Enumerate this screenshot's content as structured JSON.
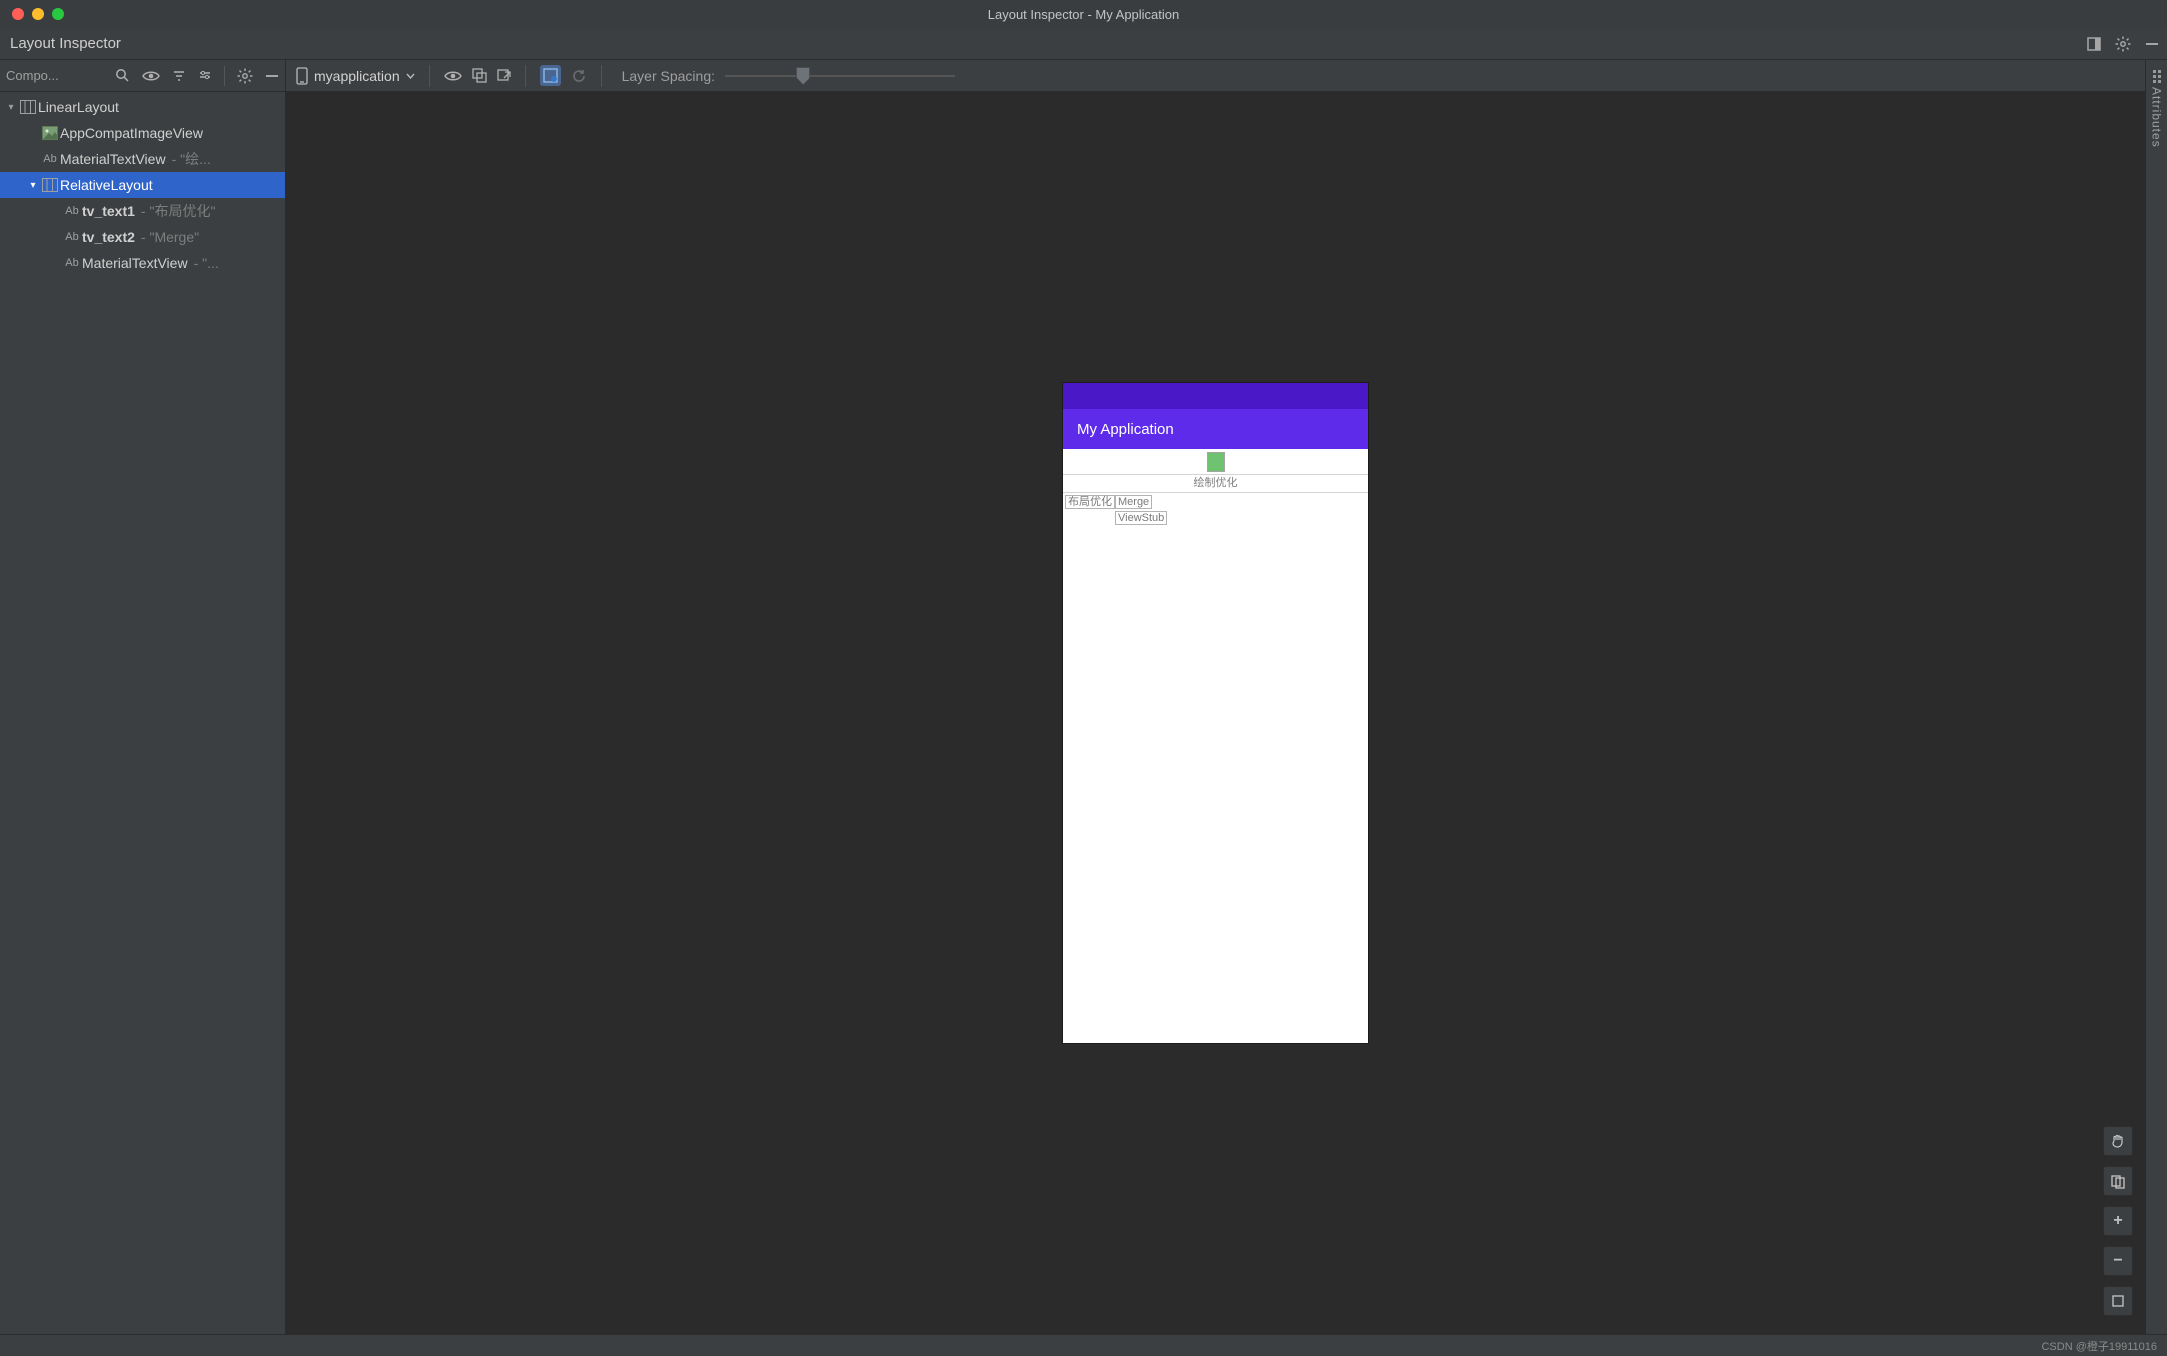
{
  "window": {
    "title": "Layout Inspector - My Application"
  },
  "header": {
    "title": "Layout Inspector"
  },
  "sidebar": {
    "title": "Compo...",
    "tree": [
      {
        "label": "LinearLayout",
        "icon": "layout",
        "indent": 0,
        "expandable": true,
        "expanded": true,
        "id_suffix": "",
        "bold": false,
        "selected": false
      },
      {
        "label": "AppCompatImageView",
        "icon": "image",
        "indent": 1,
        "expandable": false,
        "id_suffix": "",
        "bold": false,
        "selected": false
      },
      {
        "label": "MaterialTextView",
        "icon": "ab",
        "indent": 1,
        "expandable": false,
        "id_suffix": " - \"绘...",
        "bold": false,
        "selected": false
      },
      {
        "label": "RelativeLayout",
        "icon": "layout",
        "indent": 1,
        "expandable": true,
        "expanded": true,
        "id_suffix": "",
        "bold": false,
        "selected": true
      },
      {
        "label": "tv_text1",
        "icon": "ab",
        "indent": 2,
        "expandable": false,
        "id_suffix": " - \"布局优化\"",
        "bold": true,
        "selected": false
      },
      {
        "label": "tv_text2",
        "icon": "ab",
        "indent": 2,
        "expandable": false,
        "id_suffix": " - \"Merge\"",
        "bold": true,
        "selected": false
      },
      {
        "label": "MaterialTextView",
        "icon": "ab",
        "indent": 2,
        "expandable": false,
        "id_suffix": " - \"...",
        "bold": false,
        "selected": false
      }
    ]
  },
  "toolbar": {
    "device": "myapplication",
    "layer_spacing_label": "Layer Spacing:"
  },
  "device_preview": {
    "app_title": "My Application",
    "rowb_text": "绘制优化",
    "cells": {
      "c1": "布局优化",
      "c2": "Merge",
      "c3": "ViewStub"
    }
  },
  "right_panel": {
    "label": "Attributes"
  },
  "footer": {
    "watermark": "CSDN @橙子19911016"
  }
}
